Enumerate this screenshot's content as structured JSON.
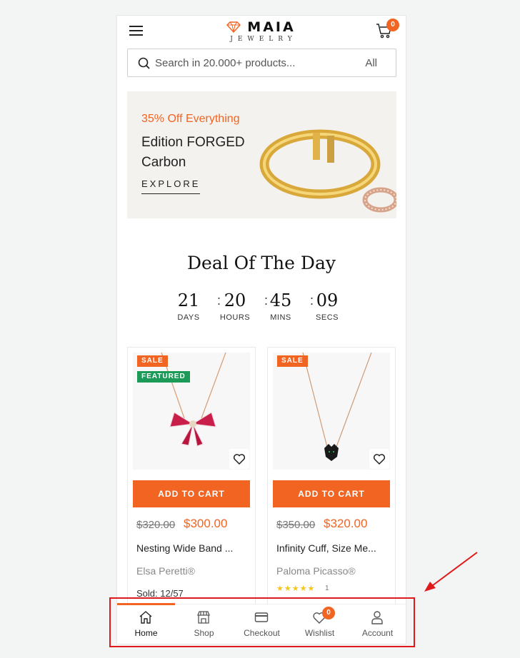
{
  "header": {
    "logo_main": "MAIA",
    "logo_sub": "JEWELRY",
    "cart_count": "0"
  },
  "search": {
    "placeholder": "Search in 20.000+ products...",
    "category": "All"
  },
  "banner": {
    "promo": "35% Off Everything",
    "title": "Edition FORGED Carbon",
    "cta": "EXPLORE"
  },
  "deal": {
    "title": "Deal Of The Day",
    "countdown": [
      {
        "value": "21",
        "label": "DAYS"
      },
      {
        "value": "20",
        "label": "HOURS"
      },
      {
        "value": "45",
        "label": "MINS"
      },
      {
        "value": "09",
        "label": "SECS"
      }
    ]
  },
  "products": [
    {
      "tags": [
        "SALE",
        "FEATURED"
      ],
      "add_to_cart": "ADD TO CART",
      "old_price": "$320.00",
      "price": "$300.00",
      "name": "Nesting Wide Band ...",
      "brand": "Elsa Peretti®",
      "sold": "Sold: 12/57"
    },
    {
      "tags": [
        "SALE"
      ],
      "add_to_cart": "ADD TO CART",
      "old_price": "$350.00",
      "price": "$320.00",
      "name": "Infinity Cuff, Size Me...",
      "brand": "Paloma Picasso®",
      "rating": 5,
      "rating_stars": "★★★★★",
      "rating_count": "1"
    }
  ],
  "bottom_nav": {
    "items": [
      {
        "label": "Home",
        "icon": "home-icon",
        "active": true
      },
      {
        "label": "Shop",
        "icon": "shop-icon"
      },
      {
        "label": "Checkout",
        "icon": "credit-card-icon"
      },
      {
        "label": "Wishlist",
        "icon": "heart-icon",
        "badge": "0"
      },
      {
        "label": "Account",
        "icon": "user-icon"
      }
    ]
  },
  "colors": {
    "accent": "#f26422",
    "featured": "#1b9b57",
    "annotation": "#e01a1a"
  }
}
